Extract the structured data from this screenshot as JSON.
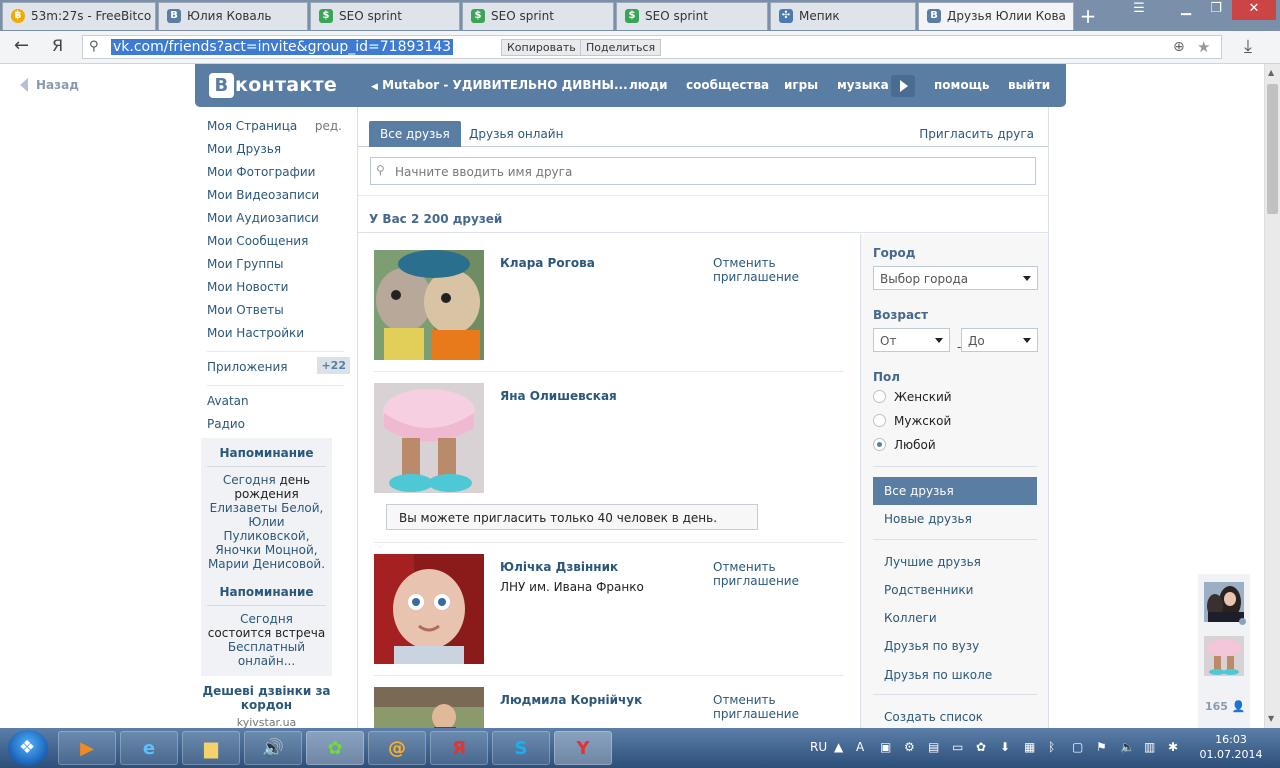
{
  "browser": {
    "tabs": [
      {
        "label": "53m:27s - FreeBitco",
        "icon": "bitcoin-icon",
        "color": "#f2a900"
      },
      {
        "label": "Юлия Коваль",
        "icon": "vk-icon",
        "color": "#597da3"
      },
      {
        "label": "SEO sprint",
        "icon": "seosprint-icon",
        "color": "#3aa655"
      },
      {
        "label": "SEO sprint",
        "icon": "seosprint-icon",
        "color": "#3aa655"
      },
      {
        "label": "SEO sprint",
        "icon": "seosprint-icon",
        "color": "#3aa655"
      },
      {
        "label": "Мепик",
        "icon": "mepik-icon",
        "color": "#4a7bb0"
      },
      {
        "label": "Друзья Юлии Кова",
        "icon": "vk-icon",
        "color": "#597da3"
      }
    ],
    "address": {
      "url": "vk.com/friends?act=invite&group_id=71893143",
      "copy_label": "Копировать",
      "share_label": "Поделиться",
      "brand": "Я"
    }
  },
  "page": {
    "back_label": "Назад",
    "header": {
      "logo_b": "В",
      "logo_text": "контакте",
      "nav": {
        "now_playing": "Mutabor - УДИВИТЕЛЬНО ДИВНЫ...",
        "people": "люди",
        "communities": "сообщества",
        "games": "игры",
        "music": "музыка",
        "help": "помощь",
        "logout": "выйти"
      }
    },
    "left_menu": {
      "items": [
        "Моя Страница",
        "Мои Друзья",
        "Мои Фотографии",
        "Мои Видеозаписи",
        "Мои Аудиозаписи",
        "Мои Сообщения",
        "Мои Группы",
        "Мои Новости",
        "Мои Ответы",
        "Мои Настройки"
      ],
      "edit_label": "ред.",
      "apps_label": "Приложения",
      "apps_badge": "+22",
      "extra": [
        "Avatan",
        "Радио"
      ]
    },
    "reminders": [
      {
        "title": "Напоминание",
        "line1_link": "Сегодня",
        "line1_text": " день рождения",
        "people": "Елизаветы Белой, Юлии Пуликовской, Яночки Моцной, Марии Денисовой."
      },
      {
        "title": "Напоминание",
        "line1_link": "Сегодня",
        "line1_text": " состоится встреча ",
        "event": "Бесплатный онлайн..."
      }
    ],
    "ad": {
      "title": "Дешеві дзвінки за кордон",
      "source": "kyivstar.ua"
    },
    "tabs": {
      "all": "Все друзья",
      "online": "Друзья онлайн",
      "invite": "Пригласить друга"
    },
    "search_placeholder": "Начните вводить имя друга",
    "friends_count": "У Вас 2 200 друзей",
    "friends": [
      {
        "name": "Клара Рогова",
        "sub": "",
        "action": "Отменить приглашение"
      },
      {
        "name": "Яна Олишевская",
        "sub": "",
        "action": ""
      },
      {
        "name": "Юлічка Дзвінник",
        "sub": "ЛНУ им. Ивана Франко",
        "action": "Отменить приглашение"
      },
      {
        "name": "Людмила Корнійчук",
        "sub": "",
        "action": "Отменить приглашение"
      }
    ],
    "limit_notice": "Вы можете пригласить только 40 человек в день.",
    "filter": {
      "city_label": "Город",
      "city_value": "Выбор города",
      "age_label": "Возраст",
      "age_from": "От",
      "age_to": "До",
      "age_dash": "-",
      "sex_label": "Пол",
      "sex_options": [
        "Женский",
        "Мужской",
        "Любой"
      ],
      "sex_selected": "Любой",
      "lists": [
        "Все друзья",
        "Новые друзья"
      ],
      "lists2": [
        "Лучшие друзья",
        "Родственники",
        "Коллеги",
        "Друзья по вузу",
        "Друзья по школе"
      ],
      "create_list": "Создать список"
    },
    "dock_count": "165"
  },
  "taskbar": {
    "language": "RU",
    "time": "16:03",
    "date": "01.07.2014",
    "apps": [
      "media-player",
      "internet-explorer",
      "file-explorer",
      "sound",
      "icq",
      "mail-agent",
      "yandex",
      "skype",
      "yandex-browser"
    ]
  }
}
